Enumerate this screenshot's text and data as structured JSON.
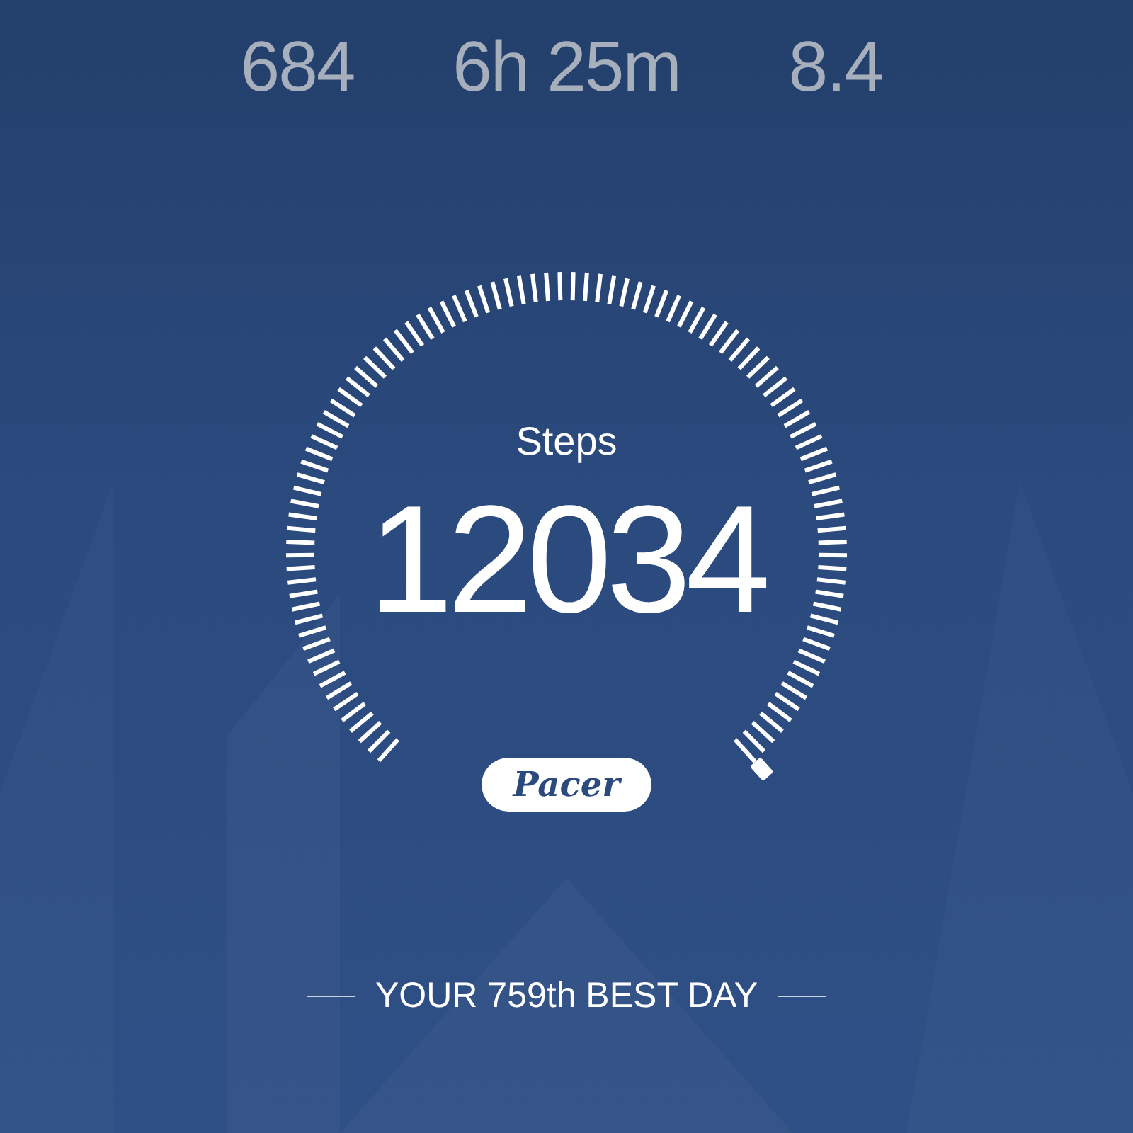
{
  "stats": [
    {
      "value": "684"
    },
    {
      "value": "6h 25m"
    },
    {
      "value": "8.4"
    }
  ],
  "gauge": {
    "label": "Steps",
    "value": "12034"
  },
  "brand": "Pacer",
  "footer": "YOUR 759th BEST DAY"
}
